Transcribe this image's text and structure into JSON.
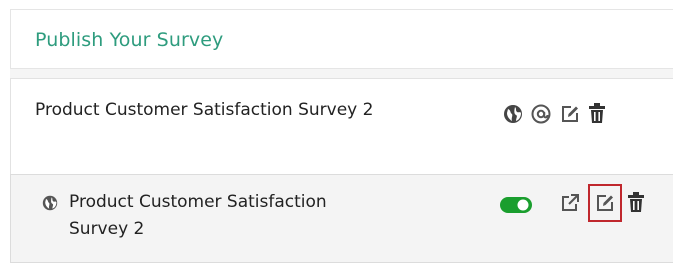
{
  "panel": {
    "title": "Publish Your Survey"
  },
  "surveys": [
    {
      "title": "Product Customer Satisfaction Survey 2",
      "icons": [
        "globe-icon",
        "at-icon",
        "edit-icon",
        "trash-icon"
      ]
    },
    {
      "title": "Product Customer Satisfaction Survey 2",
      "published_toggle": "on",
      "icons": [
        "globe-icon",
        "toggle-switch",
        "external-link-icon",
        "edit-icon",
        "trash-icon"
      ]
    }
  ],
  "colors": {
    "accent": "#2e9c7e",
    "toggle_on": "#1a9e2e",
    "highlight": "#c0272d",
    "icon": "#444444"
  }
}
